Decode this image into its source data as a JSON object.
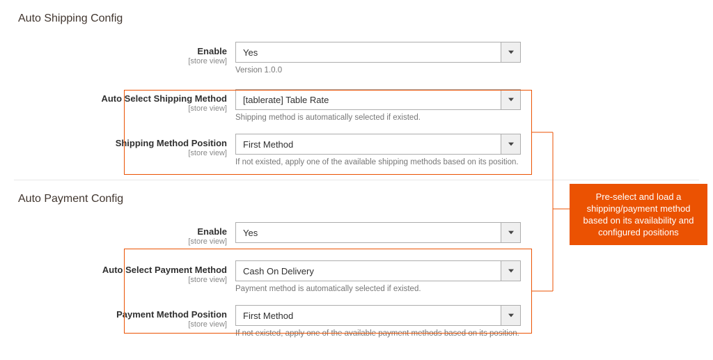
{
  "shipping": {
    "title": "Auto Shipping Config",
    "enable": {
      "label": "Enable",
      "scope": "[store view]",
      "value": "Yes",
      "version": "Version 1.0.0"
    },
    "method": {
      "label": "Auto Select Shipping Method",
      "scope": "[store view]",
      "value": "[tablerate] Table Rate",
      "helper": "Shipping method is automatically selected if existed."
    },
    "position": {
      "label": "Shipping Method Position",
      "scope": "[store view]",
      "value": "First Method",
      "helper": "If not existed, apply one of the available shipping methods based on its position."
    }
  },
  "payment": {
    "title": "Auto Payment Config",
    "enable": {
      "label": "Enable",
      "scope": "[store view]",
      "value": "Yes"
    },
    "method": {
      "label": "Auto Select Payment Method",
      "scope": "[store view]",
      "value": "Cash On Delivery",
      "helper": "Payment method is automatically selected if existed."
    },
    "position": {
      "label": "Payment Method Position",
      "scope": "[store view]",
      "value": "First Method",
      "helper": "If not existed, apply one of the available payment methods based on its position."
    }
  },
  "callout": "Pre-select and load a shipping/payment method based on its availability and configured positions"
}
